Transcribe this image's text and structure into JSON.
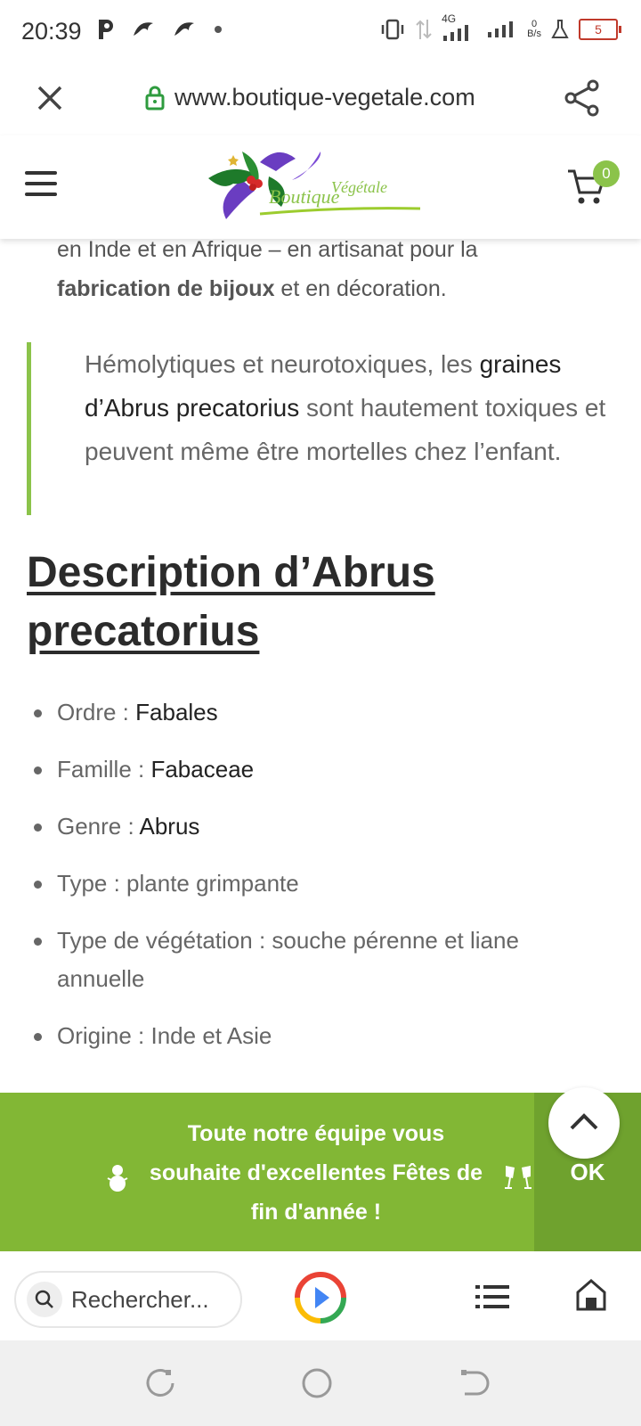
{
  "status_bar": {
    "time": "20:39",
    "network_type": "4G",
    "net_speed_value": "0",
    "net_speed_unit": "B/s",
    "battery": "5",
    "left_icons": [
      "p-icon",
      "bird-icon",
      "bird-icon",
      "dot-icon"
    ],
    "right_icons": [
      "vibrate-icon",
      "data-arrows-icon",
      "signal-icon",
      "signal-icon",
      "flask-icon",
      "battery-icon"
    ]
  },
  "browser": {
    "url": "www.boutique-vegetale.com",
    "search_placeholder": "Rechercher..."
  },
  "site": {
    "logo_text_1": "Végétale",
    "logo_text_2": "Boutique",
    "cart_count": "0"
  },
  "article": {
    "intro_line": "en Inde et en Afrique – en artisanat pour la",
    "intro_bold": "fabrication de bijoux",
    "intro_rest": " et en décoration.",
    "quote_part1": "Hémolytiques et neurotoxiques, les ",
    "quote_link": "graines d’Abrus precatorius",
    "quote_part2": " sont hautement toxiques et peuvent même être mortelles chez l’enfant.",
    "heading": "Description d’Abrus precatorius",
    "list": [
      {
        "label": "Ordre : ",
        "value": "Fabales"
      },
      {
        "label": "Famille : ",
        "value": "Fabaceae"
      },
      {
        "label": "Genre : ",
        "value": "Abrus"
      },
      {
        "label": "Type : plante grimpante",
        "value": ""
      },
      {
        "label": "Type de végétation : souche pérenne et liane annuelle",
        "value": ""
      },
      {
        "label": "Origine : Inde et Asie",
        "value": ""
      }
    ]
  },
  "banner": {
    "line1": "Toute notre équipe vous",
    "line2": "souhaite d'excellentes Fêtes de",
    "line3": "fin d'année !",
    "ok": "OK",
    "bg_color": "#82b735"
  }
}
